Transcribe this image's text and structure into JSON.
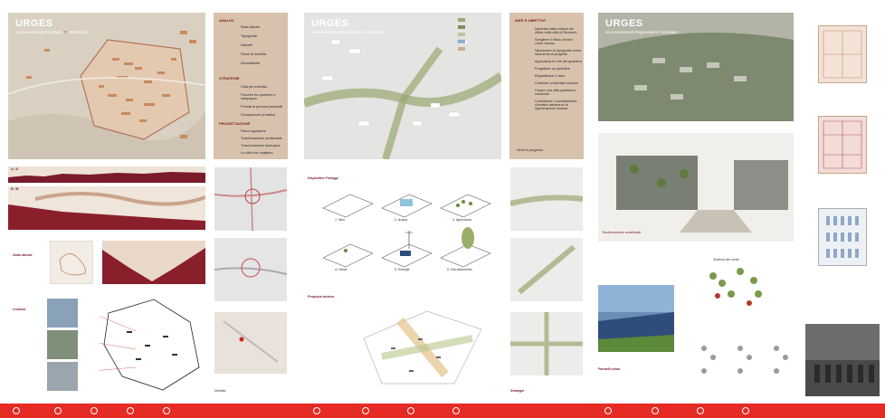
{
  "board1": {
    "title": "URGES",
    "subtitle": "Unconventional Regeneration Strategies",
    "analysis_header": "ANALISI",
    "analysis_items": [
      "Stato attuale",
      "Topografia",
      "Distretti",
      "Flussi di mobilità",
      "Accessibilità"
    ],
    "strategy_header": "STRATEGIE",
    "strategy_items": [
      "Città per individui",
      "Favorire tra quartiere e campagna",
      "Priorità ai percorsi pedonali",
      "Occupazione proattiva"
    ],
    "project_header": "PROGETTAZIONE",
    "project_items": [
      "Piano regolatore",
      "Trasformazione ambientale",
      "Trasformazione tipologica",
      "La città che vogliamo"
    ],
    "section_a": "A / A'",
    "section_b": "B / B'",
    "state_label": "Stato attuale",
    "contesti_label": "Contesti",
    "mobility_label": "Mobilità",
    "number": "01"
  },
  "board2": {
    "title": "URGES",
    "subtitle": "Unconventional Regeneration Strategies",
    "goals_header": "IDEE E OBIETTIVI",
    "goals_items": [
      "Imparare dalla cultura del rifiuto nella città di Rozzano",
      "Scegliere il rifiuto urbano come risorsa",
      "Valorizzare la topografia come strumento di progetto",
      "Agricoltura in rete del quartiere",
      "Progettare un quartiere",
      "Riqualificare il riuso",
      "Costruire un'identità comune",
      "Creare una città pubblica e condivisa",
      "Contrastare il cambiamento climatico attraverso la rigenerazione urbana"
    ],
    "work_in_progress": "Work in progress...",
    "devices_label": "Dispositivi Proteggì",
    "devices": [
      "1. Muri",
      "2. Acqua",
      "3. Agricoltura",
      "4. Verde",
      "5. Energia",
      "6. Riscaldamento"
    ],
    "plan_label": "Proposta tecnica",
    "strategy_label": "Strategie",
    "number": "02"
  },
  "board3": {
    "title": "URGES",
    "subtitle": "Unconventional Regeneration Strategies",
    "transform_label": "Trasformazione ambientale",
    "green_label": "Sistema del verde",
    "stato_label": "Stato attuale",
    "progetto_label": "Progetto",
    "plan_label": "Planta tipo",
    "energy_label": "Pannelli solari",
    "number": "03"
  },
  "colors": {
    "accent_red": "#e52b24",
    "sand": "#d8bfa8",
    "maroon": "#8a1f2c"
  }
}
